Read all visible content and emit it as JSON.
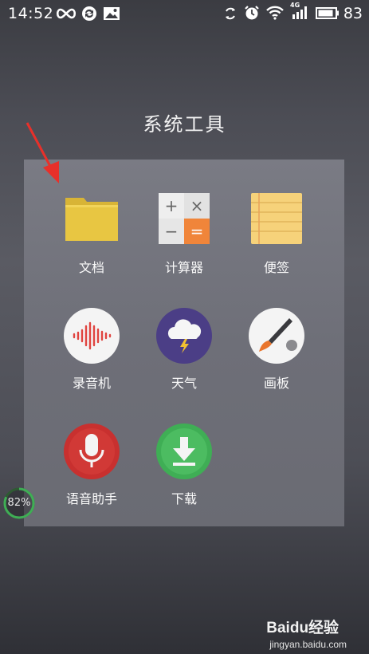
{
  "status_bar": {
    "time": "14:52",
    "battery_percent": "83",
    "icons_left": [
      "infinity-icon",
      "sync-icon",
      "image-icon"
    ],
    "icons_right": [
      "rotate-icon",
      "alarm-icon",
      "wifi-icon",
      "signal-4g-icon",
      "battery-icon"
    ],
    "network_label": "4G"
  },
  "folder": {
    "title": "系统工具",
    "apps": [
      {
        "label": "文档",
        "icon": "folder-icon"
      },
      {
        "label": "计算器",
        "icon": "calculator-icon"
      },
      {
        "label": "便签",
        "icon": "notes-icon"
      },
      {
        "label": "录音机",
        "icon": "voice-recorder-icon"
      },
      {
        "label": "天气",
        "icon": "weather-icon"
      },
      {
        "label": "画板",
        "icon": "paint-palette-icon"
      },
      {
        "label": "语音助手",
        "icon": "microphone-icon"
      },
      {
        "label": "下载",
        "icon": "download-icon"
      }
    ]
  },
  "calculator_keys": [
    "+",
    "×",
    "−",
    "="
  ],
  "memory_widget": {
    "percent_text": "82%",
    "percent": 82
  },
  "watermark": {
    "logo": "Baidu经验",
    "url": "jingyan.baidu.com"
  },
  "colors": {
    "folder_yellow": "#e8c642",
    "calc_orange": "#f0853a",
    "notes_yellow": "#f6d27a",
    "recorder_red": "#e0443f",
    "weather_purple": "#4b3e86",
    "mic_red": "#c8302f",
    "download_green": "#3fae55",
    "arrow_red": "#e8302a"
  }
}
